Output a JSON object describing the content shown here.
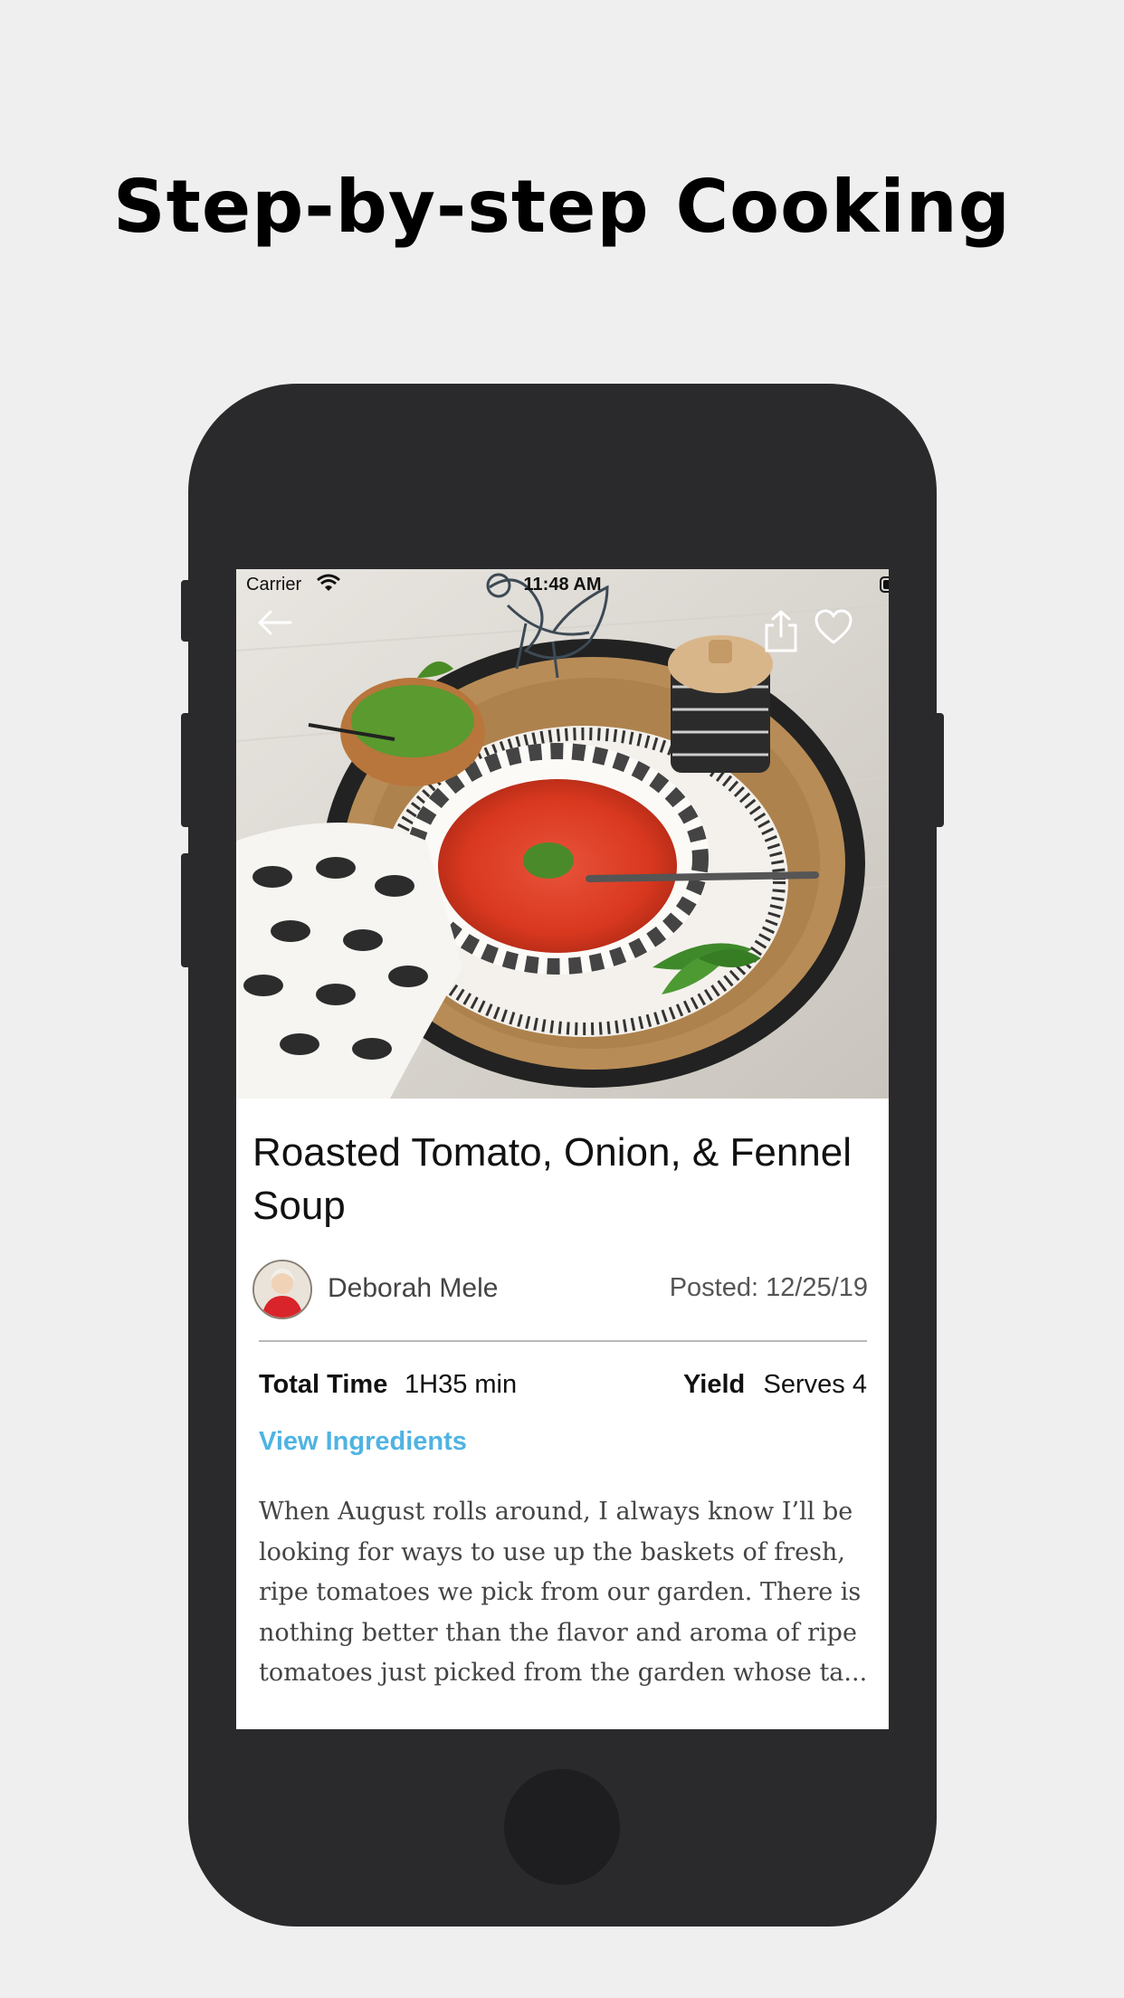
{
  "promo": {
    "headline": "Step-by-step Cooking"
  },
  "status_bar": {
    "carrier": "Carrier",
    "time": "11:48 AM"
  },
  "recipe": {
    "title": "Roasted Tomato, Onion, & Fennel Soup",
    "author": "Deborah Mele",
    "posted": "Posted: 12/25/19",
    "total_time_label": "Total Time",
    "total_time_value": "1H35 min",
    "yield_label": "Yield",
    "yield_value": "Serves 4",
    "view_ingredients": "View Ingredients",
    "description": "When August rolls around, I always know I’ll be looking for ways to use up the baskets of fresh, ripe tomatoes we pick from our garden. There is nothing better than the flavor and aroma of ripe tomatoes just picked from the garden whose ta..."
  },
  "icons": {
    "back": "back-arrow-icon",
    "share": "share-icon",
    "favorite": "heart-icon",
    "wifi": "wifi-icon",
    "battery": "battery-icon"
  },
  "colors": {
    "accent_link": "#4fb3e3",
    "phone_body": "#2a2a2c",
    "background": "#efefef"
  }
}
